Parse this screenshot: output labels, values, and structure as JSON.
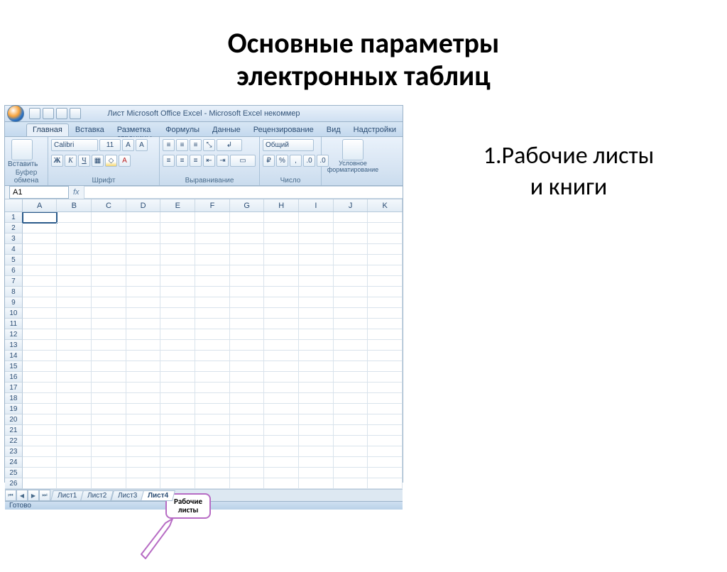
{
  "slide": {
    "title_line1": "Основные параметры",
    "title_line2": "электронных таблиц",
    "bullet_line1": "1.Рабочие листы",
    "bullet_line2": "и книги",
    "callout_line1": "Рабочие",
    "callout_line2": "листы"
  },
  "excel": {
    "title": "Лист Microsoft Office Excel - Microsoft Excel некоммер",
    "tabs": [
      "Главная",
      "Вставка",
      "Разметка страницы",
      "Формулы",
      "Данные",
      "Рецензирование",
      "Вид",
      "Надстройки"
    ],
    "active_tab_index": 0,
    "ribbon_groups": {
      "clipboard": {
        "paste": "Вставить",
        "label": "Буфер обмена"
      },
      "font": {
        "name": "Calibri",
        "size": "11",
        "label": "Шрифт"
      },
      "align": {
        "label": "Выравнивание"
      },
      "number": {
        "format": "Общий",
        "label": "Число"
      },
      "styles": {
        "cond": "Условное форматирование",
        "label": ""
      }
    },
    "namebox": "A1",
    "columns": [
      "A",
      "B",
      "C",
      "D",
      "E",
      "F",
      "G",
      "H",
      "I",
      "J",
      "K"
    ],
    "row_count": 26,
    "sheet_tabs": [
      "Лист1",
      "Лист2",
      "Лист3",
      "Лист4"
    ],
    "active_sheet_index": 3,
    "status": "Готово"
  }
}
